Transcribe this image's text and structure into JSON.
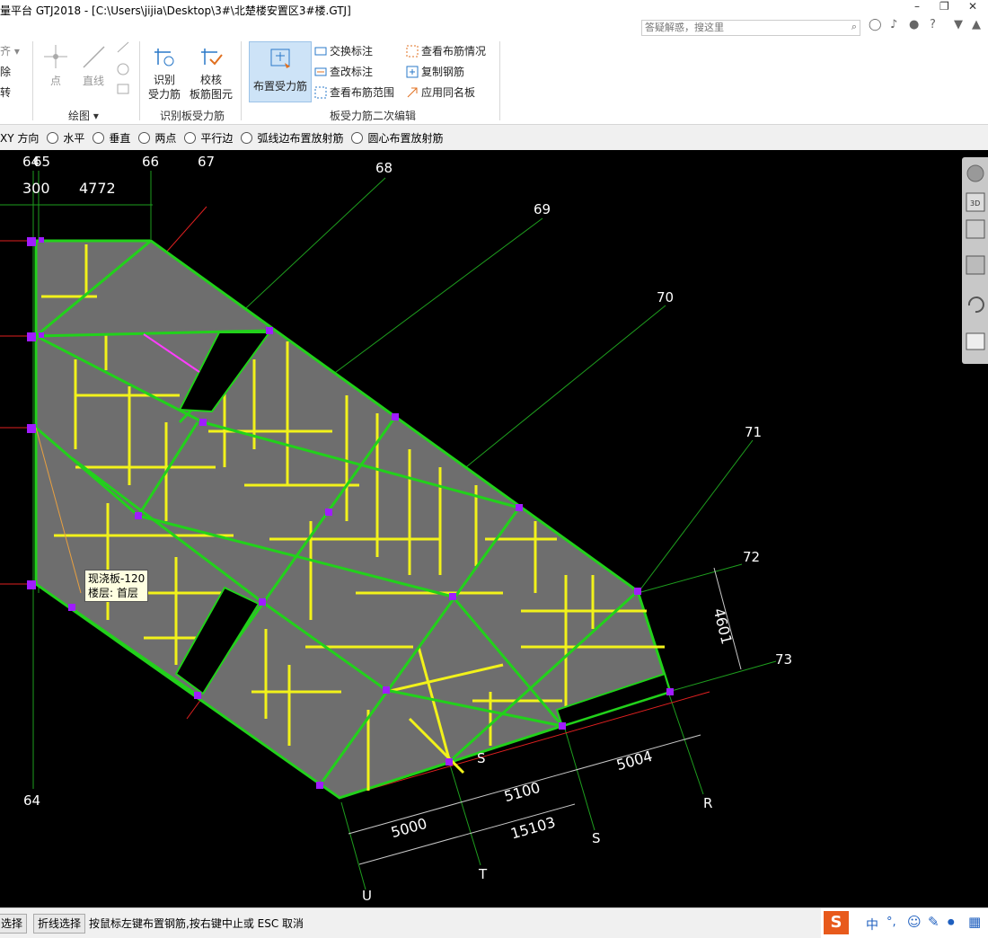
{
  "window": {
    "title": "量平台 GTJ2018 - [C:\\Users\\jijia\\Desktop\\3#\\北楚楼安置区3#楼.GTJ]",
    "search_placeholder": "答疑解惑，搜这里",
    "minimize": "–",
    "restore": "❐",
    "close": "✕"
  },
  "ribbon": {
    "left_partial": {
      "item1": "齐 ▾",
      "item2": "除",
      "item3": "转"
    },
    "draw_group": {
      "point": "点",
      "line": "直线",
      "label": "绘图 ▾"
    },
    "identify_group": {
      "identify_btn": "识别\n受力筋",
      "check_btn": "校核\n板筋图元",
      "label": "识别板受力筋"
    },
    "edit_group": {
      "place_btn": "布置受力筋",
      "swap": "交换标注",
      "check_label": "查改标注",
      "range": "查看布筋范围",
      "view": "查看布筋情况",
      "copy": "复制钢筋",
      "apply": "应用同名板",
      "label": "板受力筋二次编辑"
    }
  },
  "options": {
    "first": "XY 方向",
    "radios": [
      "水平",
      "垂直",
      "两点",
      "平行边",
      "弧线边布置放射筋",
      "圆心布置放射筋"
    ]
  },
  "drawing": {
    "axes_top": [
      "64",
      "65",
      "66",
      "67",
      "68",
      "69",
      "70",
      "71",
      "72",
      "73"
    ],
    "axes_bottom": [
      "64",
      "U",
      "T",
      "S",
      "S",
      "R"
    ],
    "dims": [
      "300",
      "4772",
      "4601",
      "5004",
      "5100",
      "5000",
      "15103"
    ],
    "tooltip": {
      "line1": "现浇板-120",
      "line2": "楼层: 首层"
    }
  },
  "status": {
    "btn1": "选择",
    "btn2": "折线选择",
    "message": "按鼠标左键布置钢筋,按右键中止或 ESC 取消",
    "ime_items": [
      "中",
      "°,"
    ]
  },
  "colors": {
    "canvas": "#000000",
    "slab": "#6e6e6e",
    "beam": "#22d11b",
    "rebar": "#f2f21a",
    "axis": "#1e9e1e",
    "grip": "#a01cff"
  }
}
